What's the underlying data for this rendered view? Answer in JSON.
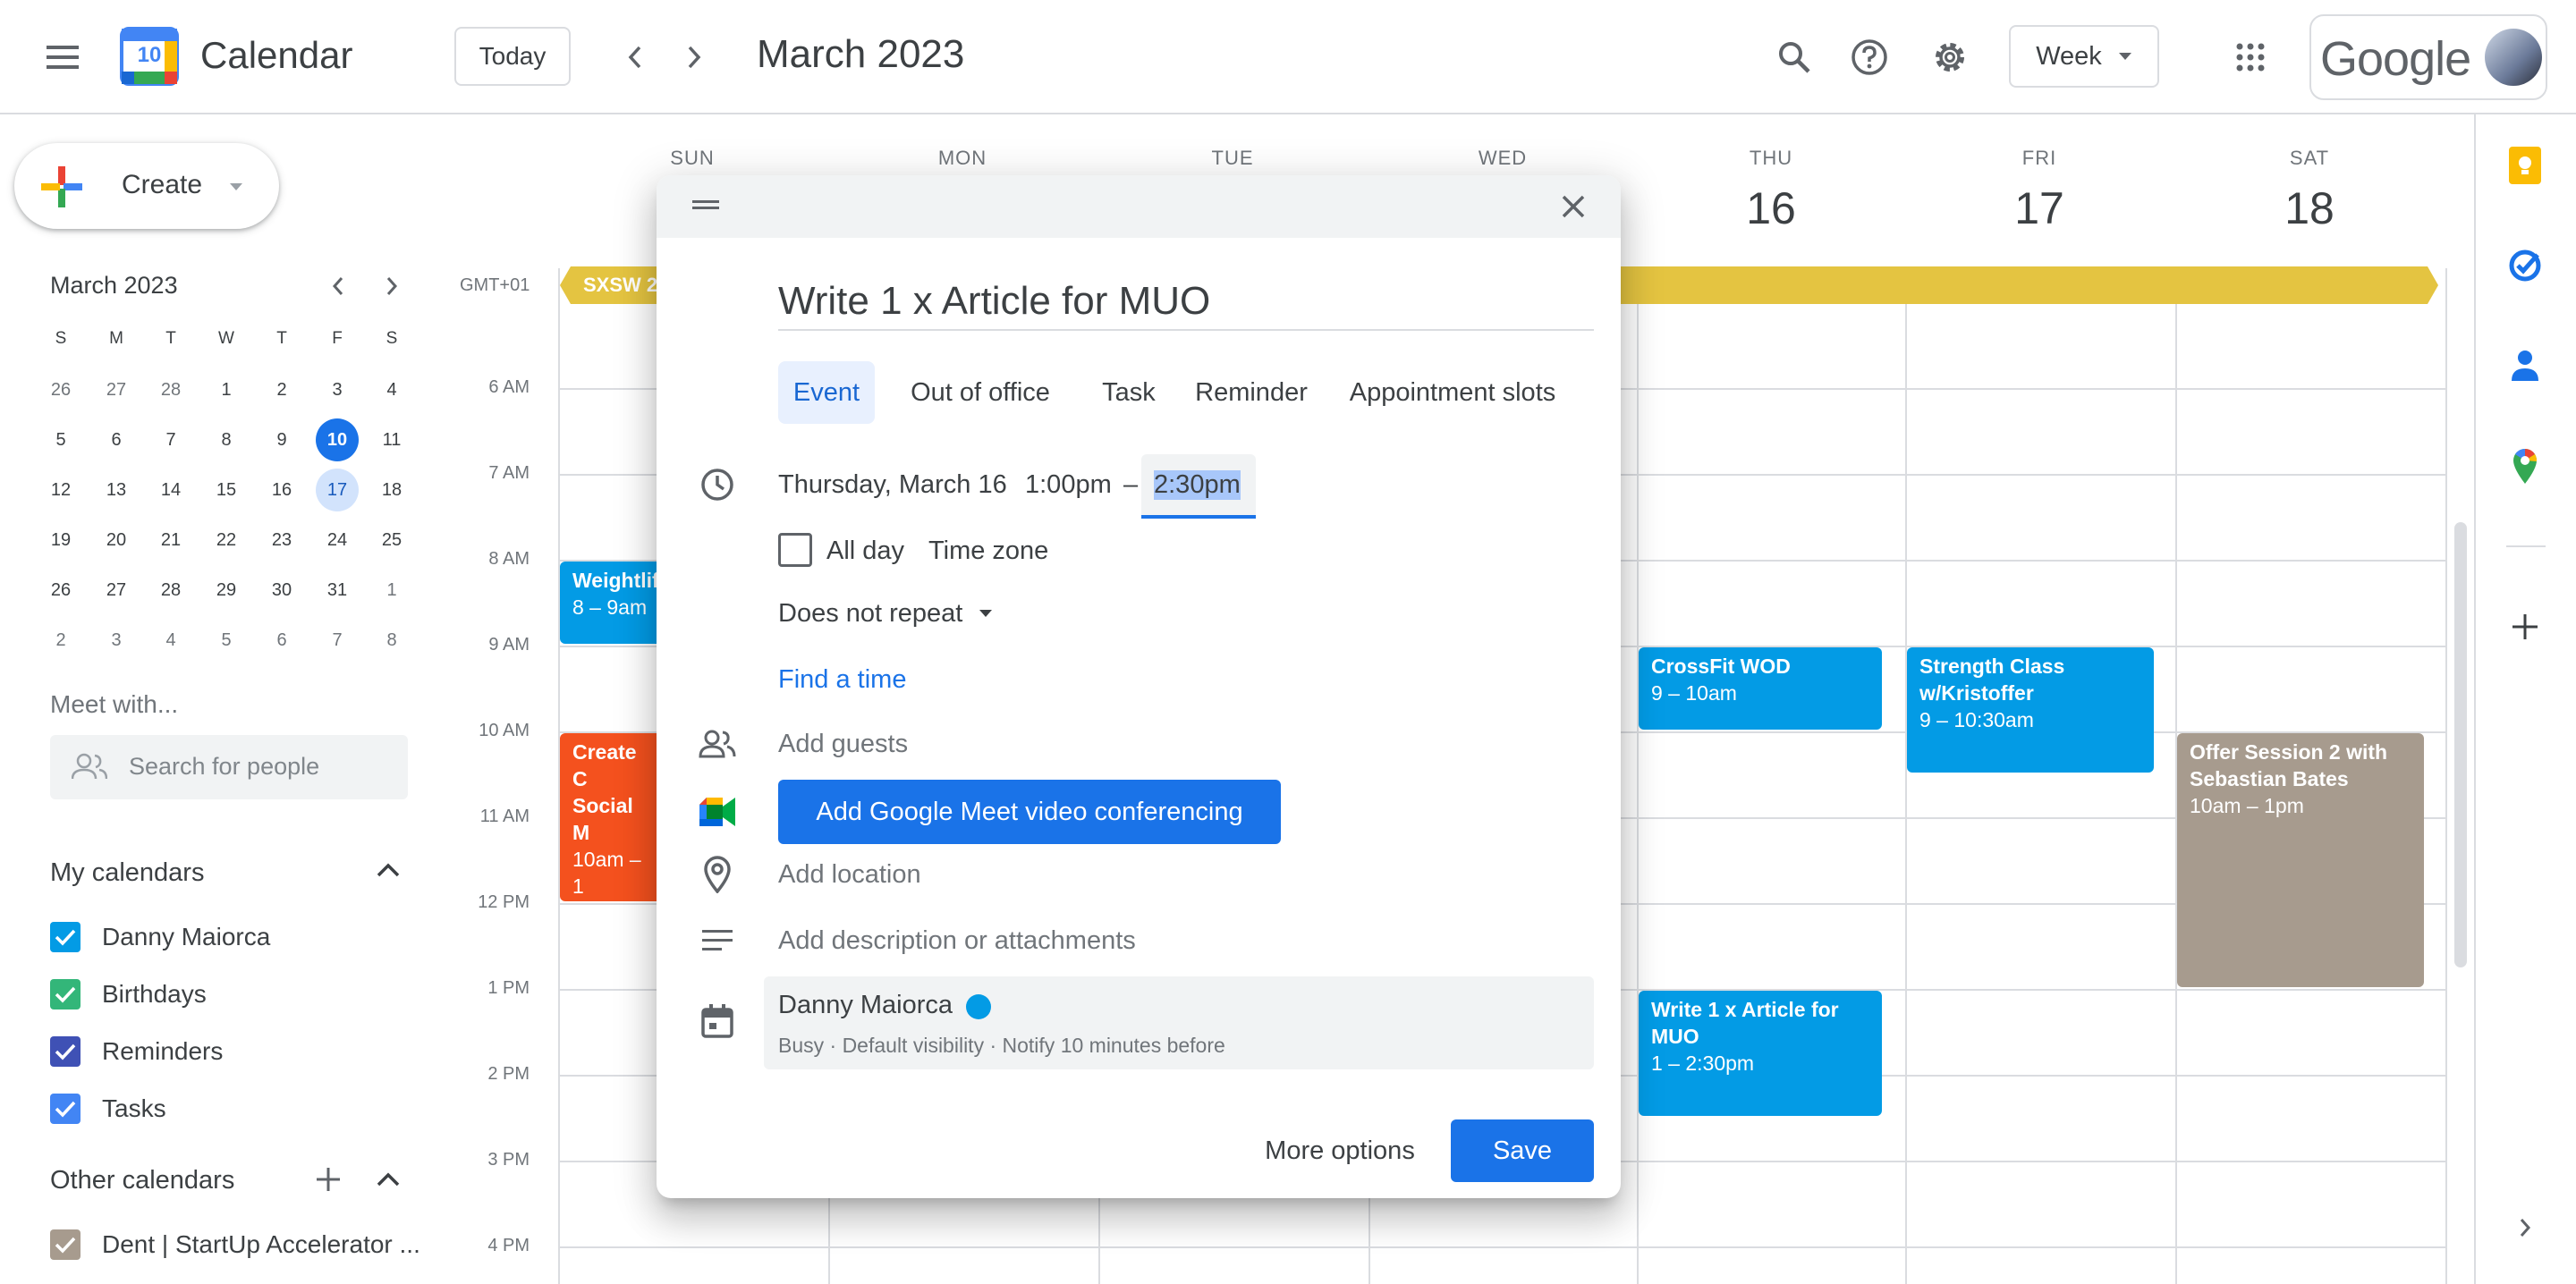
{
  "header": {
    "app_title": "Calendar",
    "logo_day": "10",
    "today_label": "Today",
    "month_title": "March 2023",
    "view_label": "Week",
    "brand_label": "Google"
  },
  "sidebar": {
    "create_label": "Create",
    "mini_month_title": "March 2023",
    "weekday_heads": [
      "S",
      "M",
      "T",
      "W",
      "T",
      "F",
      "S"
    ],
    "weeks": [
      [
        "26",
        "27",
        "28",
        "1",
        "2",
        "3",
        "4"
      ],
      [
        "5",
        "6",
        "7",
        "8",
        "9",
        "10",
        "11"
      ],
      [
        "12",
        "13",
        "14",
        "15",
        "16",
        "17",
        "18"
      ],
      [
        "19",
        "20",
        "21",
        "22",
        "23",
        "24",
        "25"
      ],
      [
        "26",
        "27",
        "28",
        "29",
        "30",
        "31",
        "1"
      ],
      [
        "2",
        "3",
        "4",
        "5",
        "6",
        "7",
        "8"
      ]
    ],
    "today_date": "10",
    "selected_date": "17",
    "meet_with_label": "Meet with...",
    "search_people_placeholder": "Search for people",
    "my_calendars_label": "My calendars",
    "my_calendars": [
      {
        "label": "Danny Maiorca",
        "color": "#039be5"
      },
      {
        "label": "Birthdays",
        "color": "#33b679"
      },
      {
        "label": "Reminders",
        "color": "#3f51b5"
      },
      {
        "label": "Tasks",
        "color": "#4285f4"
      }
    ],
    "other_calendars_label": "Other calendars",
    "other_calendars": [
      {
        "label": "Dent | StartUp Accelerator ...",
        "color": "#a79b8e"
      }
    ]
  },
  "grid": {
    "timezone_label": "GMT+01",
    "days": [
      {
        "name": "SUN",
        "num": ""
      },
      {
        "name": "MON",
        "num": ""
      },
      {
        "name": "TUE",
        "num": ""
      },
      {
        "name": "WED",
        "num": ""
      },
      {
        "name": "THU",
        "num": "16"
      },
      {
        "name": "FRI",
        "num": "17"
      },
      {
        "name": "SAT",
        "num": "18"
      }
    ],
    "hours": [
      "6 AM",
      "7 AM",
      "8 AM",
      "9 AM",
      "10 AM",
      "11 AM",
      "12 PM",
      "1 PM",
      "2 PM",
      "3 PM",
      "4 PM"
    ],
    "allday_event": "SXSW 2",
    "events": [
      {
        "title": "Weightlif",
        "time": "8 – 9am",
        "color": "#039be5"
      },
      {
        "title": "Create C",
        "title2": "Social M",
        "time": "10am – 1",
        "color": "#f4511e"
      },
      {
        "title": "CrossFit WOD",
        "time": "9 – 10am",
        "color": "#039be5"
      },
      {
        "title": "Write 1 x Article for",
        "title2": "MUO",
        "time": "1 – 2:30pm",
        "color": "#039be5"
      },
      {
        "title": "Strength Class",
        "title2": "w/Kristoffer",
        "time": "9 – 10:30am",
        "color": "#039be5"
      },
      {
        "title": "Offer Session 2 with",
        "title2": "Sebastian Bates",
        "time": "10am – 1pm",
        "color": "#a79b8e"
      }
    ],
    "allday_color": "#e4c441"
  },
  "dialog": {
    "title_value": "Write 1 x Article for MUO",
    "tabs": [
      "Event",
      "Out of office",
      "Task",
      "Reminder",
      "Appointment slots"
    ],
    "date_label": "Thursday, March 16",
    "start_time": "1:00pm",
    "dash": "–",
    "end_time": "2:30pm",
    "all_day_label": "All day",
    "time_zone_label": "Time zone",
    "repeat_label": "Does not repeat",
    "find_time_label": "Find a time",
    "add_guests_placeholder": "Add guests",
    "meet_button_label": "Add Google Meet video conferencing",
    "add_location_placeholder": "Add location",
    "add_description_placeholder": "Add description or attachments",
    "calendar_owner": "Danny Maiorca",
    "calendar_details": "Busy · Default visibility · Notify 10 minutes before",
    "more_options_label": "More options",
    "save_label": "Save"
  },
  "colors": {
    "accent": "#1a73e8",
    "event_blue": "#039be5"
  }
}
